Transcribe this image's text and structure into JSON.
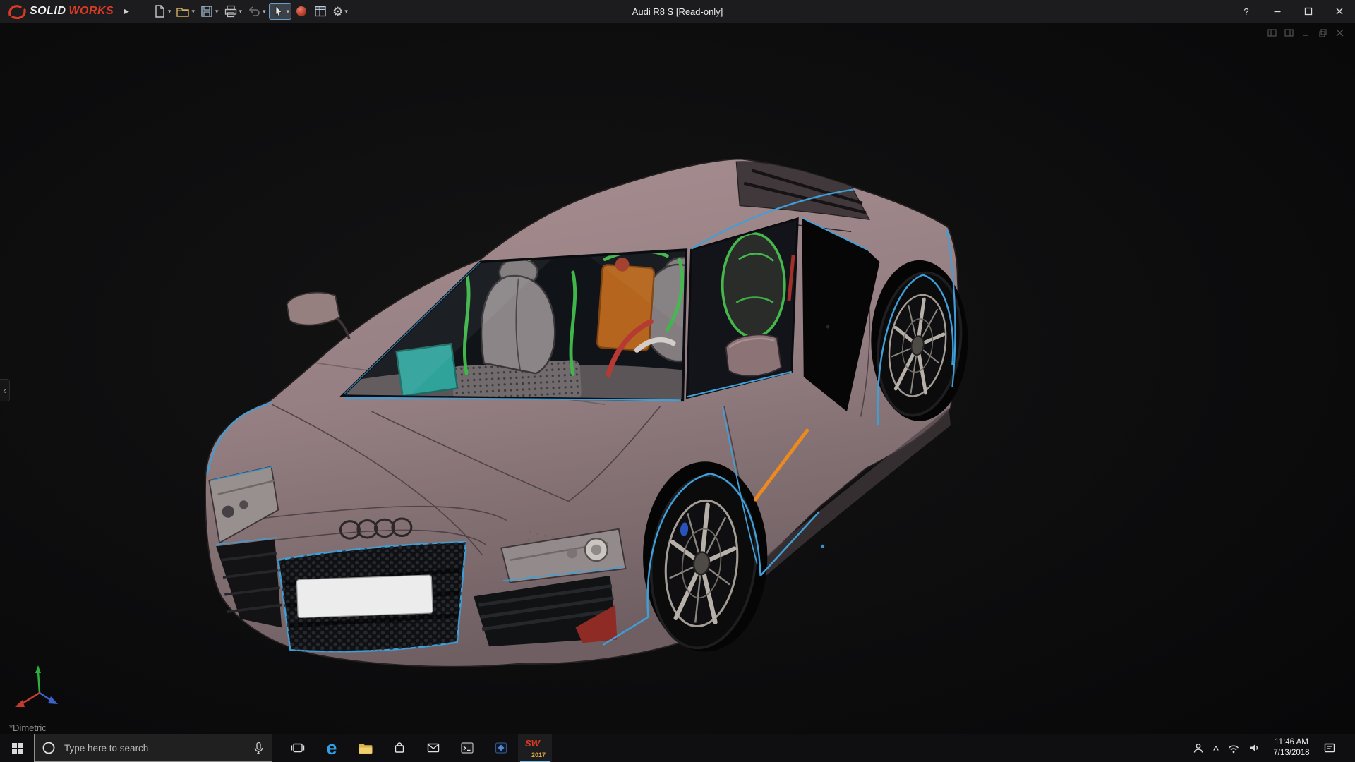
{
  "window": {
    "title": "Audi R8 S [Read-only]",
    "brand": {
      "solid": "SOLID",
      "works": "WORKS"
    },
    "flyout": "▶",
    "help": "?"
  },
  "toolbar": {
    "caret": "▾",
    "gear_glyph": "⚙",
    "icons": [
      {
        "name": "new-document-icon"
      },
      {
        "name": "open-folder-icon"
      },
      {
        "name": "save-icon"
      },
      {
        "name": "print-icon"
      },
      {
        "name": "undo-icon"
      },
      {
        "name": "select-cursor-icon"
      },
      {
        "name": "macro-sphere-icon"
      },
      {
        "name": "options-table-icon"
      },
      {
        "name": "settings-gear-icon"
      }
    ]
  },
  "viewport": {
    "view_label": "*Dimetric",
    "panel_arrow": "‹"
  },
  "taskbar": {
    "search_placeholder": "Type here to search",
    "edge_glyph": "e",
    "sw_glyph": "SW",
    "sw_year": "2017",
    "tray_chevron": "^",
    "clock": {
      "time": "11:46 AM",
      "date": "7/13/2018"
    }
  },
  "colors": {
    "accent-blue": "#3f9fd8",
    "accent-orange": "#ec8a1e",
    "car-body": "#978083",
    "interior-green": "#3fb54a",
    "brand-red": "#d83b25",
    "titlebar-bg": "#1c1c1e",
    "viewport-bg": "#0b0b0c",
    "taskbar-bg": "#0f0f11"
  }
}
